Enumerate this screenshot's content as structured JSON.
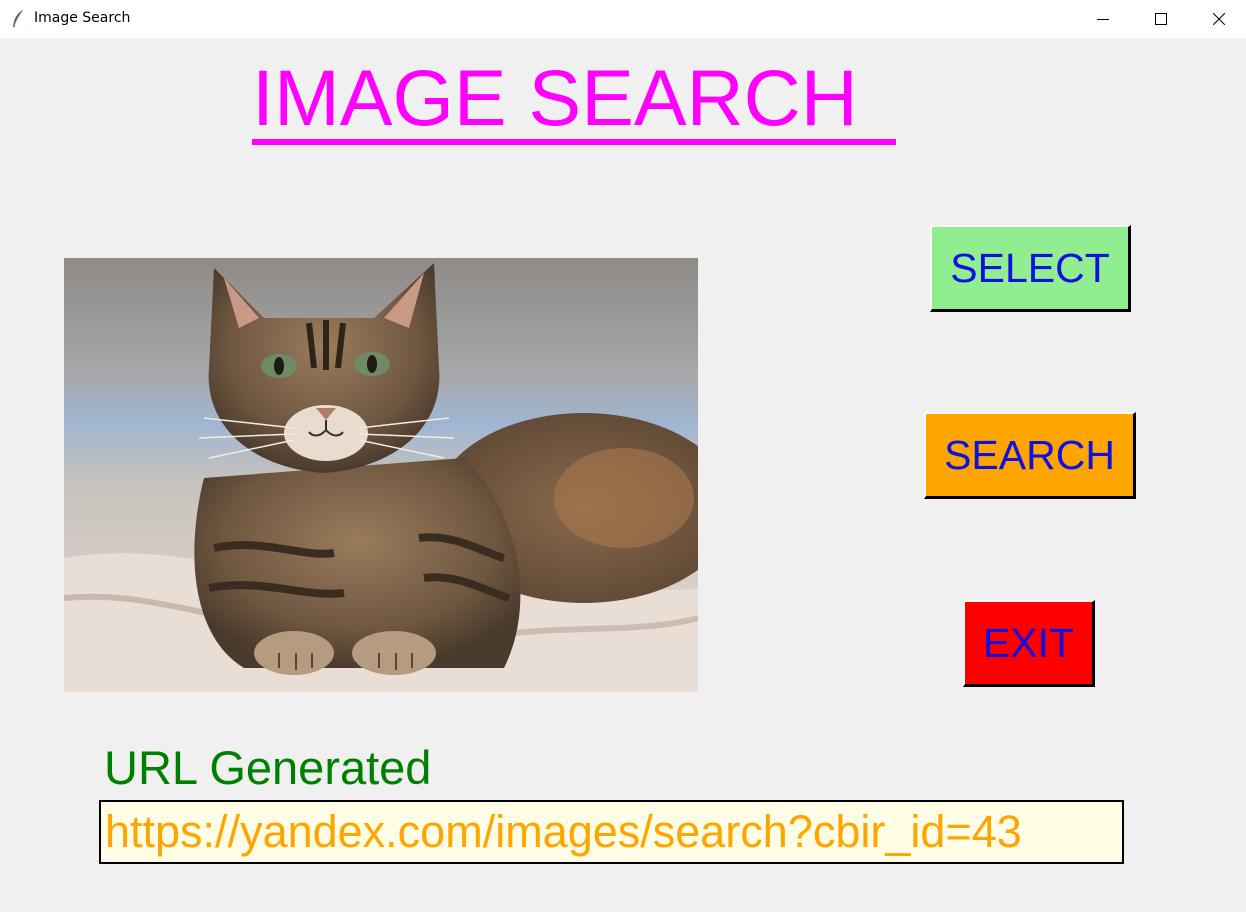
{
  "window": {
    "title": "Image Search",
    "app_icon": "feather-icon",
    "controls": [
      "minimize-icon",
      "maximize-icon",
      "close-icon"
    ]
  },
  "heading": {
    "text": "IMAGE SEARCH",
    "color": "#ff00ff"
  },
  "preview": {
    "subject": "tabby cat lying on a bed"
  },
  "buttons": {
    "select_label": "SELECT",
    "search_label": "SEARCH",
    "exit_label": "EXIT",
    "select_color": "#90ee90",
    "search_color": "#ffa500",
    "exit_color": "#ff0000",
    "text_color": "#1010e0"
  },
  "result": {
    "label": "URL Generated",
    "label_color": "#008000",
    "url": "https://yandex.com/images/search?cbir_id=43",
    "url_color": "#ffa500"
  }
}
